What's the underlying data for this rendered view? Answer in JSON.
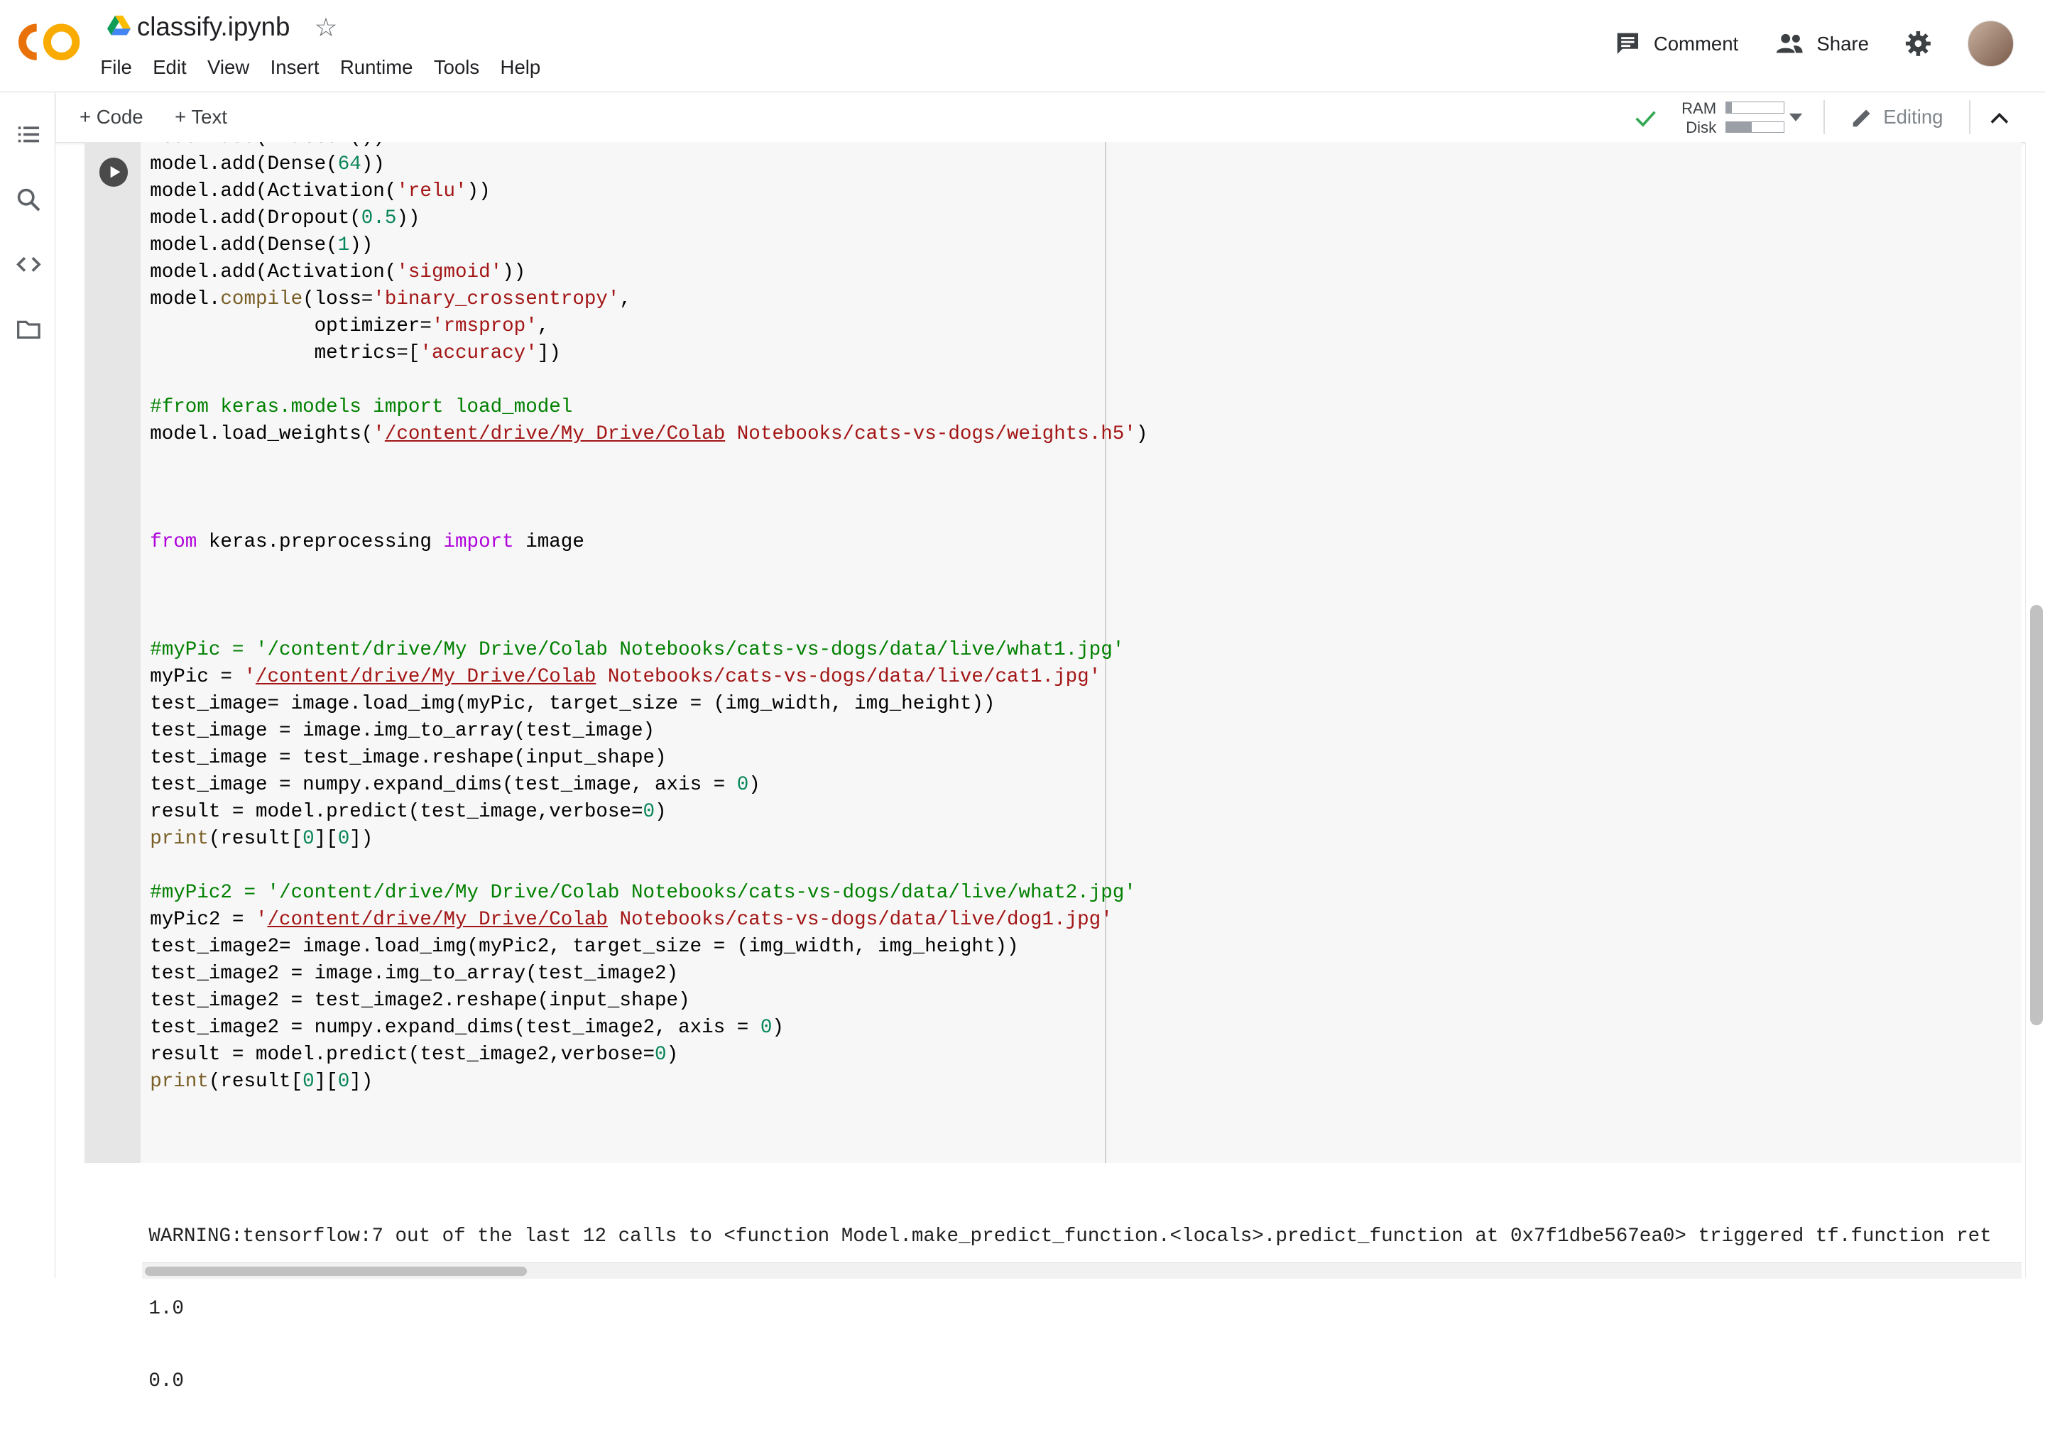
{
  "header": {
    "file_name": "classify.ipynb",
    "menu": [
      "File",
      "Edit",
      "Insert",
      "Runtime",
      "Tools",
      "Help",
      "View"
    ],
    "menu_order": [
      "File",
      "Edit",
      "View",
      "Insert",
      "Runtime",
      "Tools",
      "Help"
    ],
    "comment_label": "Comment",
    "share_label": "Share"
  },
  "toolbar": {
    "add_code_label": "+ Code",
    "add_text_label": "+ Text",
    "ram_label": "RAM",
    "disk_label": "Disk",
    "ram_usage": 0.1,
    "disk_usage": 0.45,
    "editing_label": "Editing"
  },
  "code_lines": [
    "model.add(Flatten())",
    "model.add(Dense(64))",
    "model.add(Activation('relu'))",
    "model.add(Dropout(0.5))",
    "model.add(Dense(1))",
    "model.add(Activation('sigmoid'))",
    "model.compile(loss='binary_crossentropy',",
    "              optimizer='rmsprop',",
    "              metrics=['accuracy'])",
    "",
    "#from keras.models import load_model",
    "model.load_weights('/content/drive/My Drive/Colab Notebooks/cats-vs-dogs/weights.h5')",
    "",
    "",
    "",
    "from keras.preprocessing import image",
    "",
    "",
    "",
    "#myPic = '/content/drive/My Drive/Colab Notebooks/cats-vs-dogs/data/live/what1.jpg'",
    "myPic = '/content/drive/My Drive/Colab Notebooks/cats-vs-dogs/data/live/cat1.jpg'",
    "test_image= image.load_img(myPic, target_size = (img_width, img_height))",
    "test_image = image.img_to_array(test_image)",
    "test_image = test_image.reshape(input_shape)",
    "test_image = numpy.expand_dims(test_image, axis = 0)",
    "result = model.predict(test_image,verbose=0)",
    "print(result[0][0])",
    "",
    "#myPic2 = '/content/drive/My Drive/Colab Notebooks/cats-vs-dogs/data/live/what2.jpg'",
    "myPic2 = '/content/drive/My Drive/Colab Notebooks/cats-vs-dogs/data/live/dog1.jpg'",
    "test_image2= image.load_img(myPic2, target_size = (img_width, img_height))",
    "test_image2 = image.img_to_array(test_image2)",
    "test_image2 = test_image2.reshape(input_shape)",
    "test_image2 = numpy.expand_dims(test_image2, axis = 0)",
    "result = model.predict(test_image2,verbose=0)",
    "print(result[0][0])"
  ],
  "output_lines": [
    "WARNING:tensorflow:7 out of the last 12 calls to <function Model.make_predict_function.<locals>.predict_function at 0x7f1dbe567ea0> triggered tf.function ret",
    "1.0",
    "0.0"
  ],
  "colors": {
    "keyword": "#af00db",
    "string": "#a31515",
    "number": "#098658",
    "comment": "#008000",
    "function": "#795e26",
    "logo_orange": "#f9ab00",
    "logo_dark_orange": "#e8710a",
    "check_green": "#34a853"
  },
  "icons": [
    "colab-logo-icon",
    "drive-icon",
    "star-icon",
    "comment-icon",
    "share-people-icon",
    "gear-icon",
    "toc-icon",
    "search-icon",
    "code-snippets-icon",
    "folder-icon",
    "check-icon",
    "dropdown-arrow-icon",
    "pencil-icon",
    "chevron-up-icon",
    "run-cell-icon"
  ]
}
